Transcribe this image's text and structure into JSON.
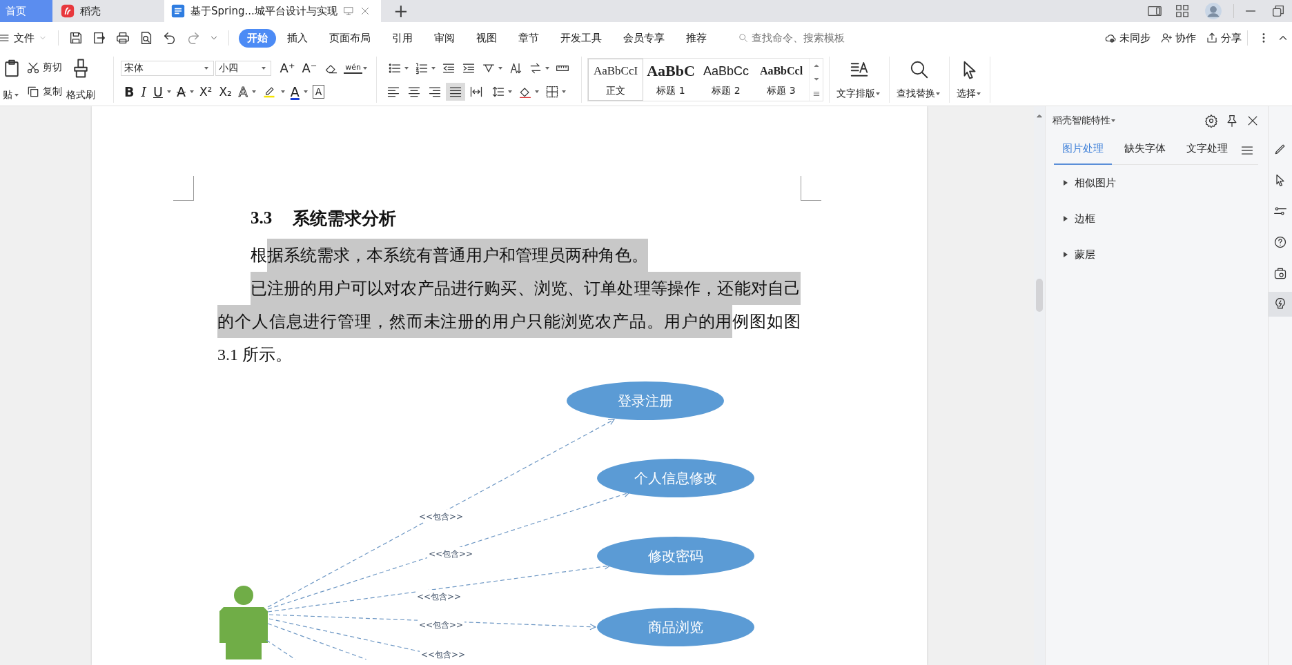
{
  "title_bar": {
    "tabs": [
      {
        "kind": "home",
        "label": "首页",
        "selected": false
      },
      {
        "kind": "docer",
        "label": "稻壳",
        "selected": false
      },
      {
        "kind": "document",
        "label": "基于Spring...城平台设计与实现",
        "selected": true
      }
    ],
    "new_tab": "+"
  },
  "menu_bar": {
    "file": "文件",
    "tabs": [
      {
        "label": "开始",
        "selected": true
      },
      {
        "label": "插入",
        "selected": false
      },
      {
        "label": "页面布局",
        "selected": false
      },
      {
        "label": "引用",
        "selected": false
      },
      {
        "label": "审阅",
        "selected": false
      },
      {
        "label": "视图",
        "selected": false
      },
      {
        "label": "章节",
        "selected": false
      },
      {
        "label": "开发工具",
        "selected": false
      },
      {
        "label": "会员专享",
        "selected": false
      },
      {
        "label": "推荐",
        "selected": false
      }
    ],
    "search": {
      "placeholder": "查找命令、搜索模板"
    },
    "actions": [
      {
        "kind": "sync",
        "label": "未同步"
      },
      {
        "kind": "collab",
        "label": "协作"
      },
      {
        "kind": "share",
        "label": "分享"
      }
    ]
  },
  "ribbon": {
    "clipboard": {
      "paste": "贴",
      "cut": "剪切",
      "copy": "复制",
      "format_painter": "格式刷"
    },
    "font": {
      "name": "宋体",
      "size": "小四"
    },
    "font_tools": [
      {
        "kind": "grow",
        "glyph": "A⁺"
      },
      {
        "kind": "shrink",
        "glyph": "A⁻"
      },
      {
        "kind": "eraser"
      },
      {
        "kind": "pinyin",
        "glyph": "wén"
      }
    ],
    "font_styles": [
      {
        "kind": "bold",
        "glyph": "B"
      },
      {
        "kind": "italic",
        "glyph": "I"
      },
      {
        "kind": "underline",
        "glyph": "U"
      },
      {
        "kind": "strike",
        "glyph": "A"
      },
      {
        "kind": "super",
        "glyph": "X²"
      },
      {
        "kind": "sub",
        "glyph": "X₂"
      },
      {
        "kind": "effect",
        "glyph": "A"
      },
      {
        "kind": "highlight"
      },
      {
        "kind": "color",
        "glyph": "A"
      },
      {
        "kind": "border",
        "glyph": "A"
      }
    ],
    "alignment": [
      {
        "kind": "left",
        "selected": false
      },
      {
        "kind": "center",
        "selected": false
      },
      {
        "kind": "right",
        "selected": false
      },
      {
        "kind": "justify",
        "selected": true
      },
      {
        "kind": "distributed",
        "selected": false
      }
    ],
    "styles": [
      {
        "kind": "body",
        "sample": "AaBbCcI",
        "label": "正文",
        "selected": true
      },
      {
        "kind": "h1",
        "sample": "AaBbC",
        "label": "标题 1",
        "selected": false
      },
      {
        "kind": "h2",
        "sample": "AaBbCc",
        "label": "标题 2",
        "selected": false
      },
      {
        "kind": "h3",
        "sample": "AaBbCcl",
        "label": "标题 3",
        "selected": false
      }
    ],
    "tools": [
      {
        "kind": "layout",
        "label": "文字排版"
      },
      {
        "kind": "find",
        "label": "查找替换"
      },
      {
        "kind": "select",
        "label": "选择"
      }
    ]
  },
  "document": {
    "heading": {
      "number": "3.3",
      "title": "系统需求分析"
    },
    "paragraphs": [
      {
        "segments": [
          {
            "text": "根",
            "selected": false
          },
          {
            "text": "据系统需求，本系统有普通用户和管理员两种角色。",
            "selected": true
          }
        ]
      },
      {
        "segments": [
          {
            "text": "已注册的用户可以对农产品进行购买、浏览、订单处理等操作，还能对自己的个人信息进行管理，然而未注册的用户只能浏览农产品。用户的用",
            "selected": true
          },
          {
            "text": "例图如图 3.1 所示。",
            "selected": false
          }
        ]
      }
    ],
    "diagram": {
      "use_cases": [
        "登录注册",
        "个人信息修改",
        "修改密码",
        "商品浏览"
      ],
      "relations": [
        "<<包含>>",
        "<<包含>>",
        "<<包含>>",
        "<<包含>>",
        "<<包含>>"
      ]
    }
  },
  "side_panel": {
    "title": "稻壳智能特性",
    "tabs": [
      {
        "label": "图片处理",
        "selected": true
      },
      {
        "label": "缺失字体",
        "selected": false
      },
      {
        "label": "文字处理",
        "selected": false
      }
    ],
    "sections": [
      {
        "label": "相似图片",
        "expanded": false
      },
      {
        "label": "边框",
        "expanded": false
      },
      {
        "label": "蒙层",
        "expanded": false
      }
    ]
  }
}
